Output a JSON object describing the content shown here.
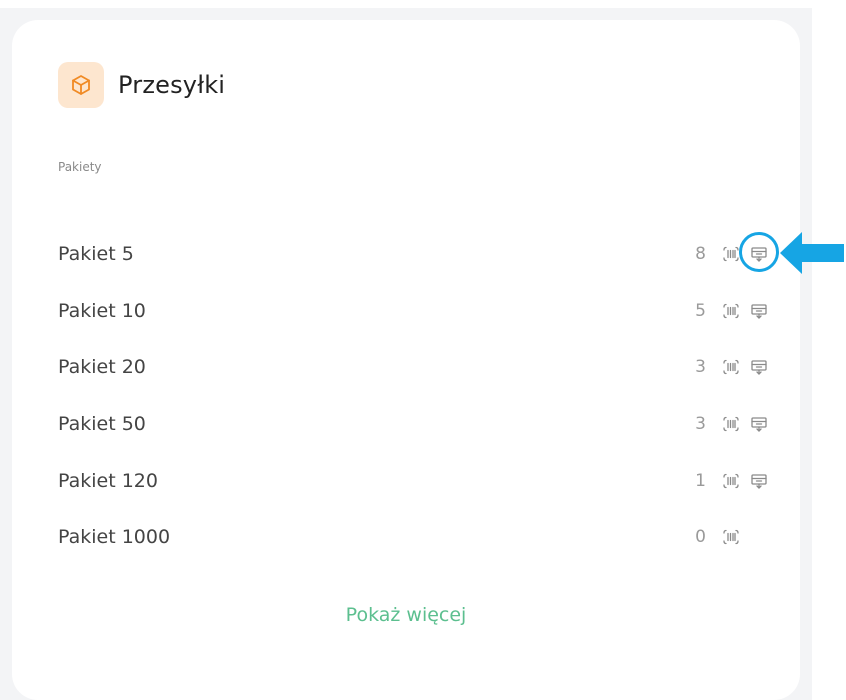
{
  "card": {
    "title": "Przesyłki",
    "icon": "package-box-icon",
    "section_label": "Pakiety",
    "show_more_label": "Pokaż więcej"
  },
  "packages": [
    {
      "name": "Pakiet 5",
      "count": "8",
      "has_barcode": true,
      "has_voucher": true,
      "highlighted": true
    },
    {
      "name": "Pakiet 10",
      "count": "5",
      "has_barcode": true,
      "has_voucher": true,
      "highlighted": false
    },
    {
      "name": "Pakiet 20",
      "count": "3",
      "has_barcode": true,
      "has_voucher": true,
      "highlighted": false
    },
    {
      "name": "Pakiet 50",
      "count": "3",
      "has_barcode": true,
      "has_voucher": true,
      "highlighted": false
    },
    {
      "name": "Pakiet 120",
      "count": "1",
      "has_barcode": true,
      "has_voucher": true,
      "highlighted": false
    },
    {
      "name": "Pakiet 1000",
      "count": "0",
      "has_barcode": true,
      "has_voucher": false,
      "highlighted": false
    }
  ],
  "colors": {
    "accent_green": "#5cbf8f",
    "annotation_blue": "#16a5e4",
    "header_icon_bg": "#fde6cf",
    "header_icon_stroke": "#f08a24"
  }
}
